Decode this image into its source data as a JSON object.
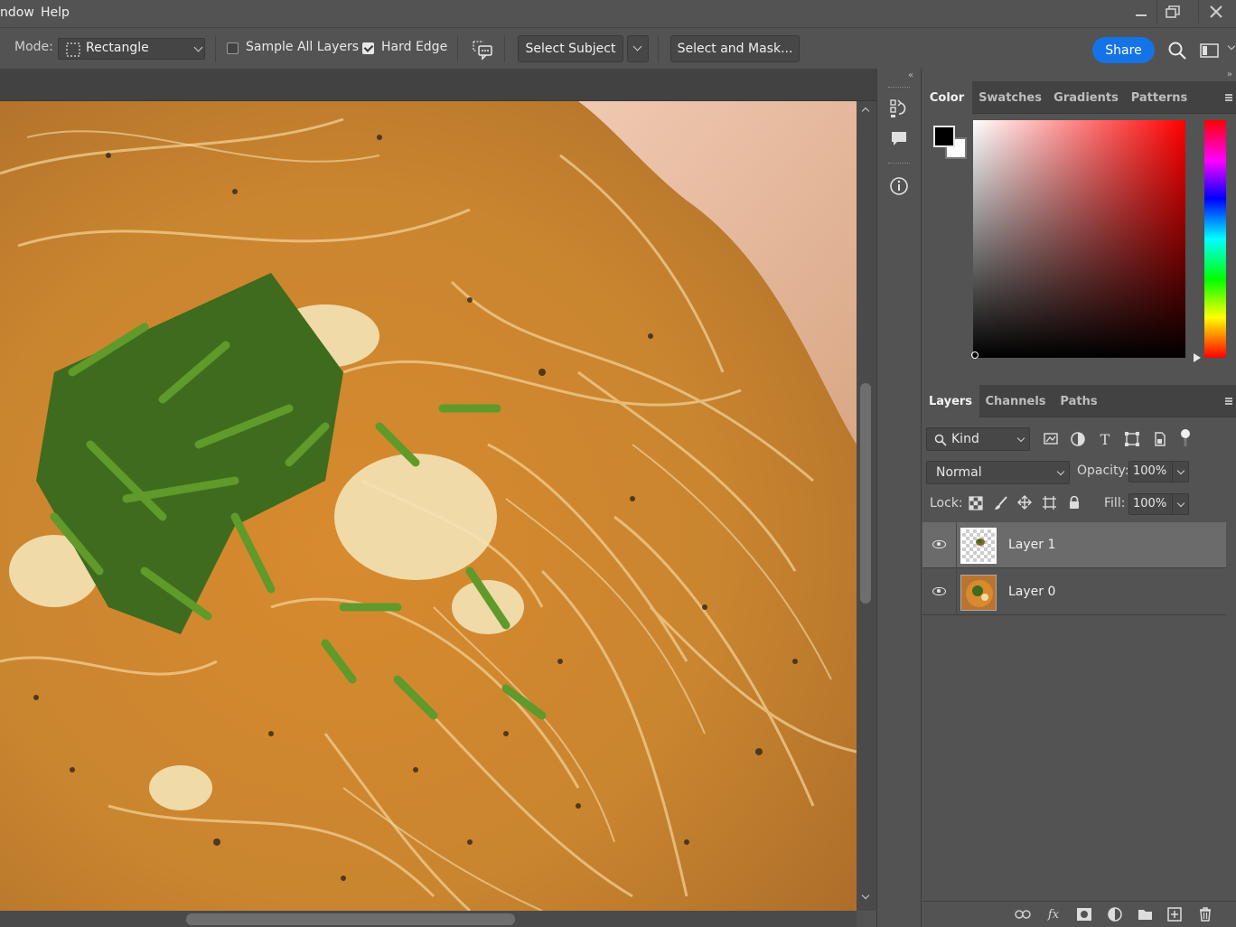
{
  "menubar": {
    "items": [
      "ndow",
      "Help"
    ],
    "window_controls": [
      "minimize-icon",
      "restore-icon",
      "close-icon"
    ]
  },
  "options_bar": {
    "mode_label": "Mode:",
    "mode_value": "Rectangle",
    "sample_all_layers": {
      "label": "Sample All Layers",
      "checked": false
    },
    "hard_edge": {
      "label": "Hard Edge",
      "checked": true
    },
    "select_subject_label": "Select Subject",
    "select_and_mask_label": "Select and Mask...",
    "share_label": "Share",
    "colors": {
      "share": "#1473e6"
    }
  },
  "color_panel": {
    "tabs": [
      "Color",
      "Swatches",
      "Gradients",
      "Patterns"
    ],
    "active_tab": "Color",
    "foreground": "#000000",
    "background": "#ffffff",
    "hue": "#ff0000"
  },
  "layers_panel": {
    "tabs": [
      "Layers",
      "Channels",
      "Paths"
    ],
    "active_tab": "Layers",
    "filter_label": "Kind",
    "blend_mode": "Normal",
    "opacity_label": "Opacity:",
    "opacity_value": "100%",
    "lock_label": "Lock:",
    "fill_label": "Fill:",
    "fill_value": "100%",
    "layers": [
      {
        "name": "Layer 1",
        "selected": true,
        "visible": true,
        "transparent": true
      },
      {
        "name": "Layer 0",
        "selected": false,
        "visible": true,
        "transparent": false
      }
    ],
    "footer_icons": [
      "link-icon",
      "fx-icon",
      "mask-icon",
      "adjustment-icon",
      "folder-icon",
      "new-layer-icon",
      "trash-icon"
    ],
    "fx_label": "fx"
  },
  "canvas": {
    "content": "photo: spaghetti with cream sauce, chopped chives and grated cheese"
  }
}
